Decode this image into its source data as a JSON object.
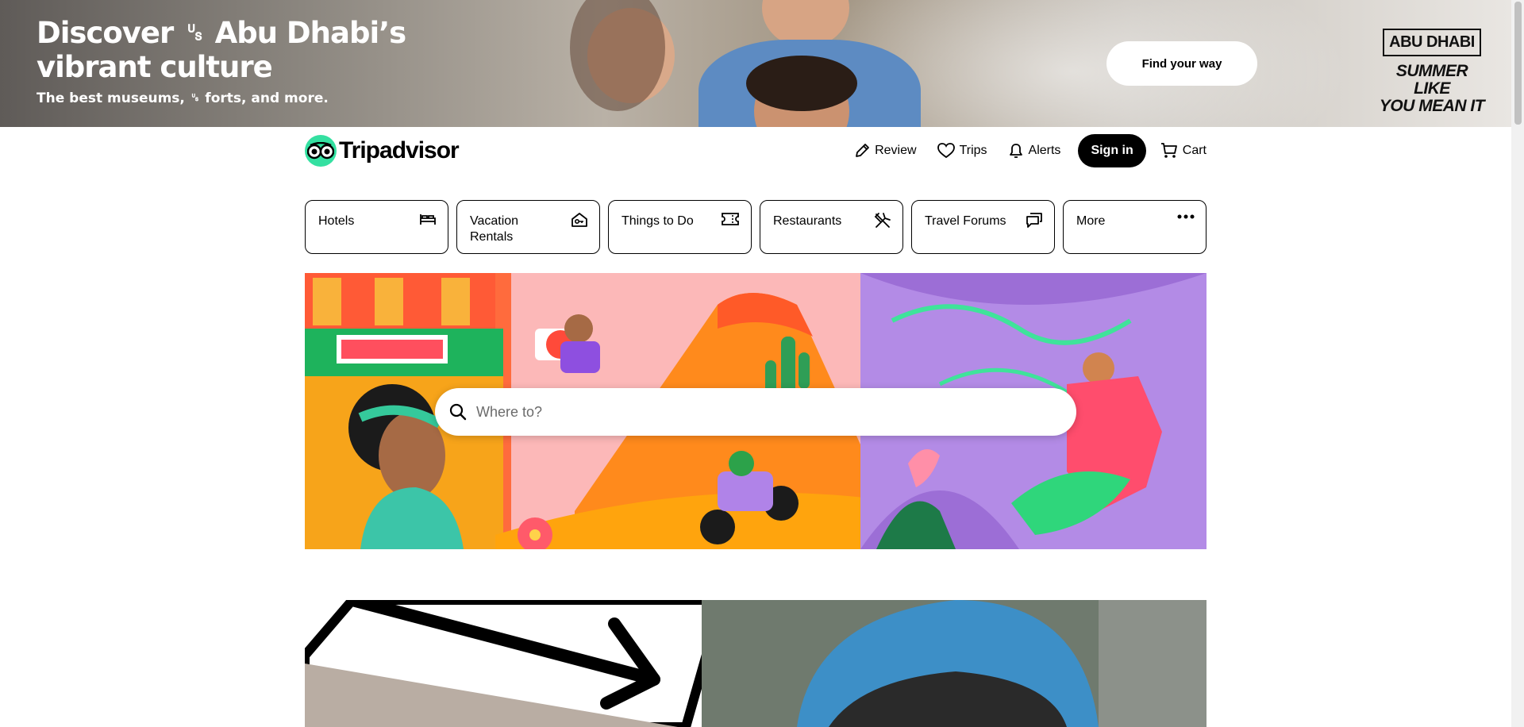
{
  "ad": {
    "headline_line1": "Discover ␟ Abu Dhabi’s",
    "headline_line2": "vibrant culture",
    "subline": "The best museums, ␟ forts, and more.",
    "cta_label": "Find your way",
    "brand_name": "ABU DHABI",
    "brand_tag_line1": "SUMMER LIKE",
    "brand_tag_line2": "YOU MEAN IT"
  },
  "header": {
    "logo_text": "Tripadvisor",
    "nav": {
      "review": "Review",
      "trips": "Trips",
      "alerts": "Alerts",
      "sign_in": "Sign in",
      "cart": "Cart"
    }
  },
  "tabs": [
    {
      "label": "Hotels",
      "icon": "bed-icon"
    },
    {
      "label": "Vacation Rentals",
      "icon": "house-key-icon"
    },
    {
      "label": "Things to Do",
      "icon": "ticket-icon"
    },
    {
      "label": "Restaurants",
      "icon": "utensils-icon"
    },
    {
      "label": "Travel Forums",
      "icon": "chat-icon"
    },
    {
      "label": "More",
      "icon": "more-dots-icon"
    }
  ],
  "search": {
    "placeholder": "Where to?"
  },
  "colors": {
    "brand_green": "#34e0a1",
    "black": "#000000",
    "hero_pink": "#fcb8b8",
    "hero_orange": "#fca60b",
    "hero_purple": "#9c6ed6"
  }
}
